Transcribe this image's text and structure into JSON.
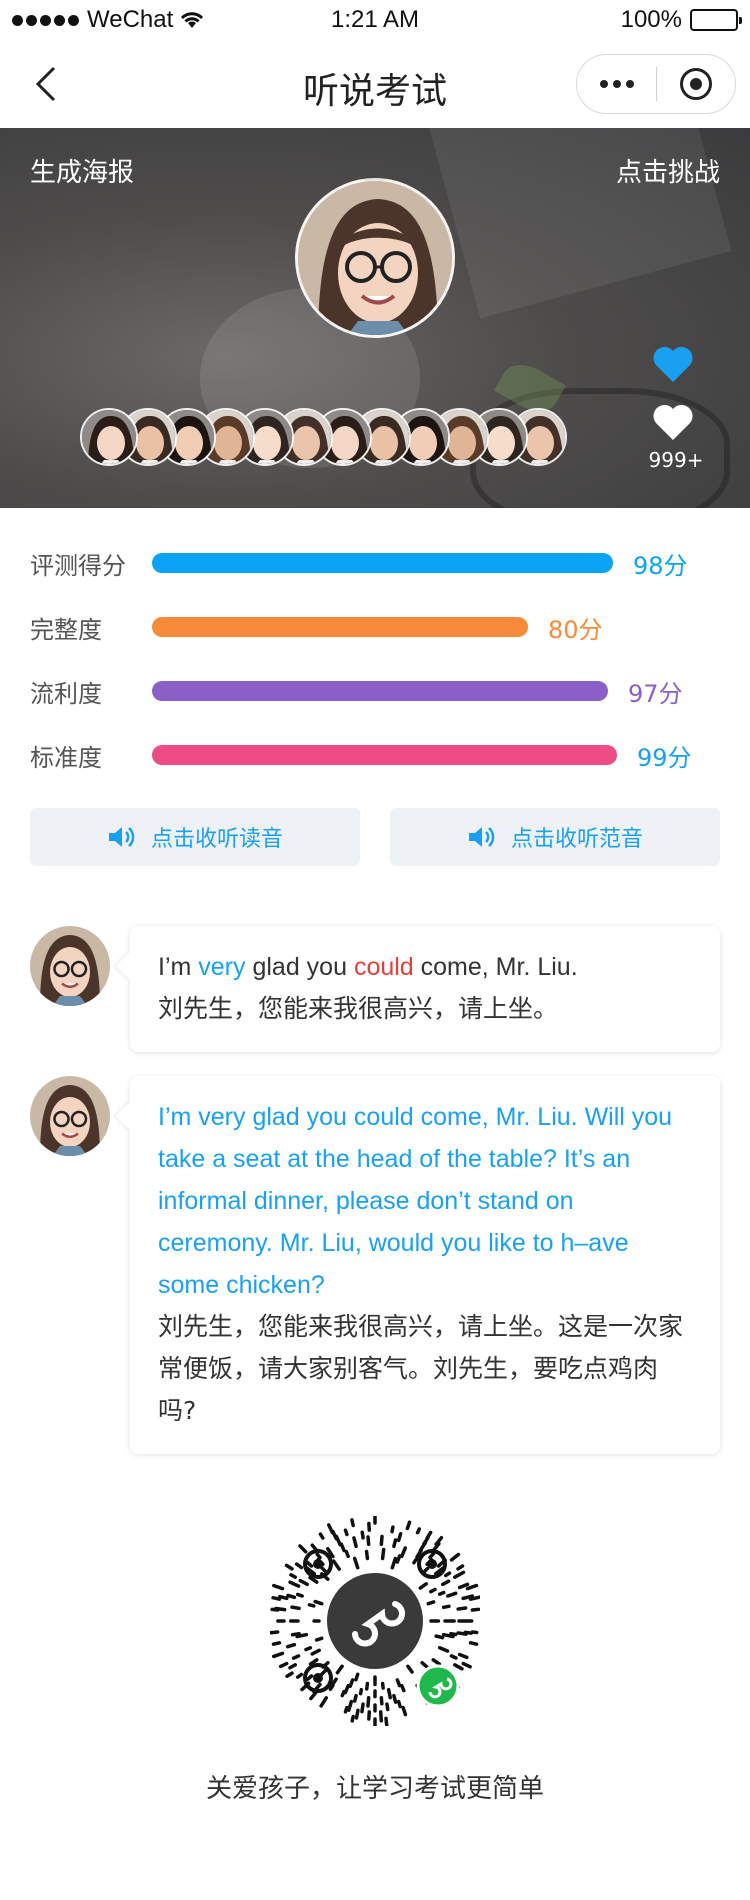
{
  "status_bar": {
    "carrier": "WeChat",
    "time": "1:21 AM",
    "battery": "100%"
  },
  "nav": {
    "title": "听说考试"
  },
  "hero": {
    "poster_label": "生成海报",
    "challenge_label": "点击挑战",
    "like_count": "999+",
    "participant_count": 12
  },
  "scores": [
    {
      "label": "评测得分",
      "value": 98,
      "value_text": "98分",
      "color": "#0aa3f5"
    },
    {
      "label": "完整度",
      "value": 80,
      "value_text": "80分",
      "color": "#f88a3a"
    },
    {
      "label": "流利度",
      "value": 97,
      "value_text": "97分",
      "color": "#8b5fc8"
    },
    {
      "label": "标准度",
      "value": 99,
      "value_text": "99分",
      "color": "#ee4c84"
    }
  ],
  "listen_buttons": {
    "read": "点击收听读音",
    "sample": "点击收听范音",
    "icon": "speaker-icon"
  },
  "chat": [
    {
      "en_parts": [
        "I’m ",
        "very",
        " glad you ",
        "could",
        " come, Mr. Liu."
      ],
      "zh": "刘先生，您能来我很高兴，请上坐。"
    },
    {
      "en": "I’m very glad you could come, Mr. Liu. Will you take a seat at the head of the table? It’s an informal dinner, please don’t stand on ceremony. Mr. Liu, would you like to h–ave some chicken?",
      "zh": "刘先生，您能来我很高兴，请上坐。这是一次家常便饭，请大家别客气。刘先生，要吃点鸡肉吗?"
    }
  ],
  "footer": {
    "slogan": "关爱孩子，让学习考试更简单"
  },
  "colors": {
    "accent_blue": "#1aa0f0",
    "highlight_red": "#e2403a",
    "mini_program_green": "#1fb84a"
  }
}
